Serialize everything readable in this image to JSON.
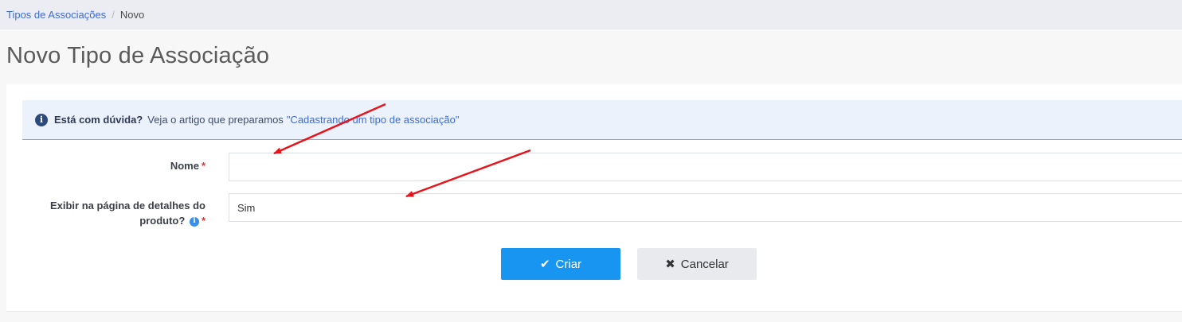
{
  "breadcrumb": {
    "parent": "Tipos de Associações",
    "current": "Novo"
  },
  "page": {
    "title": "Novo Tipo de Associação"
  },
  "help": {
    "title": "Está com dúvida?",
    "text": "Veja o artigo que preparamos",
    "link": "\"Cadastrando um tipo de associação\""
  },
  "form": {
    "nome_label": "Nome",
    "nome_value": "",
    "exibir_label": "Exibir na página de detalhes do produto?",
    "exibir_value": "Sim",
    "required_mark": "*"
  },
  "actions": {
    "create_label": "Criar",
    "cancel_label": "Cancelar"
  },
  "colors": {
    "primary": "#1795f0",
    "annotation_arrow": "#e8141b"
  }
}
